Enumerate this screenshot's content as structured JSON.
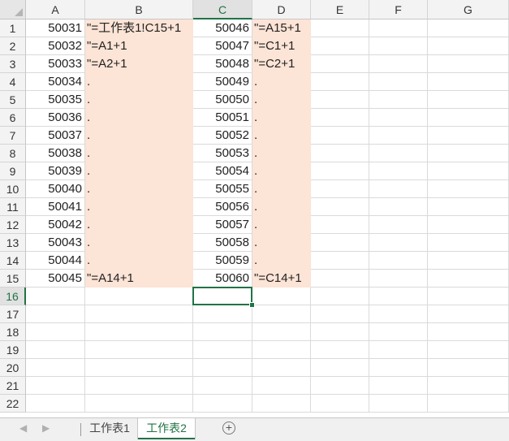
{
  "columns": [
    "A",
    "B",
    "C",
    "D",
    "E",
    "F",
    "G"
  ],
  "selected_column": "C",
  "rows": [
    "1",
    "2",
    "3",
    "4",
    "5",
    "6",
    "7",
    "8",
    "9",
    "10",
    "11",
    "12",
    "13",
    "14",
    "15",
    "16",
    "17",
    "18",
    "19",
    "20",
    "21",
    "22"
  ],
  "selected_row": "16",
  "selected_cell": "C16",
  "cells": {
    "A": [
      "50031",
      "50032",
      "50033",
      "50034",
      "50035",
      "50036",
      "50037",
      "50038",
      "50039",
      "50040",
      "50041",
      "50042",
      "50043",
      "50044",
      "50045"
    ],
    "B": [
      "\"=工作表1!C15+1",
      "\"=A1+1",
      "\"=A2+1",
      ".",
      ".",
      ".",
      ".",
      ".",
      ".",
      ".",
      ".",
      ".",
      ".",
      ".",
      "\"=A14+1"
    ],
    "C": [
      "50046",
      "50047",
      "50048",
      "50049",
      "50050",
      "50051",
      "50052",
      "50053",
      "50054",
      "50055",
      "50056",
      "50057",
      "50058",
      "50059",
      "50060"
    ],
    "D": [
      "\"=A15+1",
      "\"=C1+1",
      "\"=C2+1",
      ".",
      ".",
      ".",
      ".",
      ".",
      ".",
      ".",
      ".",
      ".",
      ".",
      ".",
      "\"=C14+1"
    ]
  },
  "fill_color": "#fce4d6",
  "accent_color": "#217346",
  "sheet_tabs": [
    {
      "label": "工作表1",
      "active": false
    },
    {
      "label": "工作表2",
      "active": true
    }
  ],
  "icons": {
    "prev_sheet": "triangle-left-icon",
    "next_sheet": "triangle-right-icon",
    "add_sheet": "plus-circle-icon"
  }
}
